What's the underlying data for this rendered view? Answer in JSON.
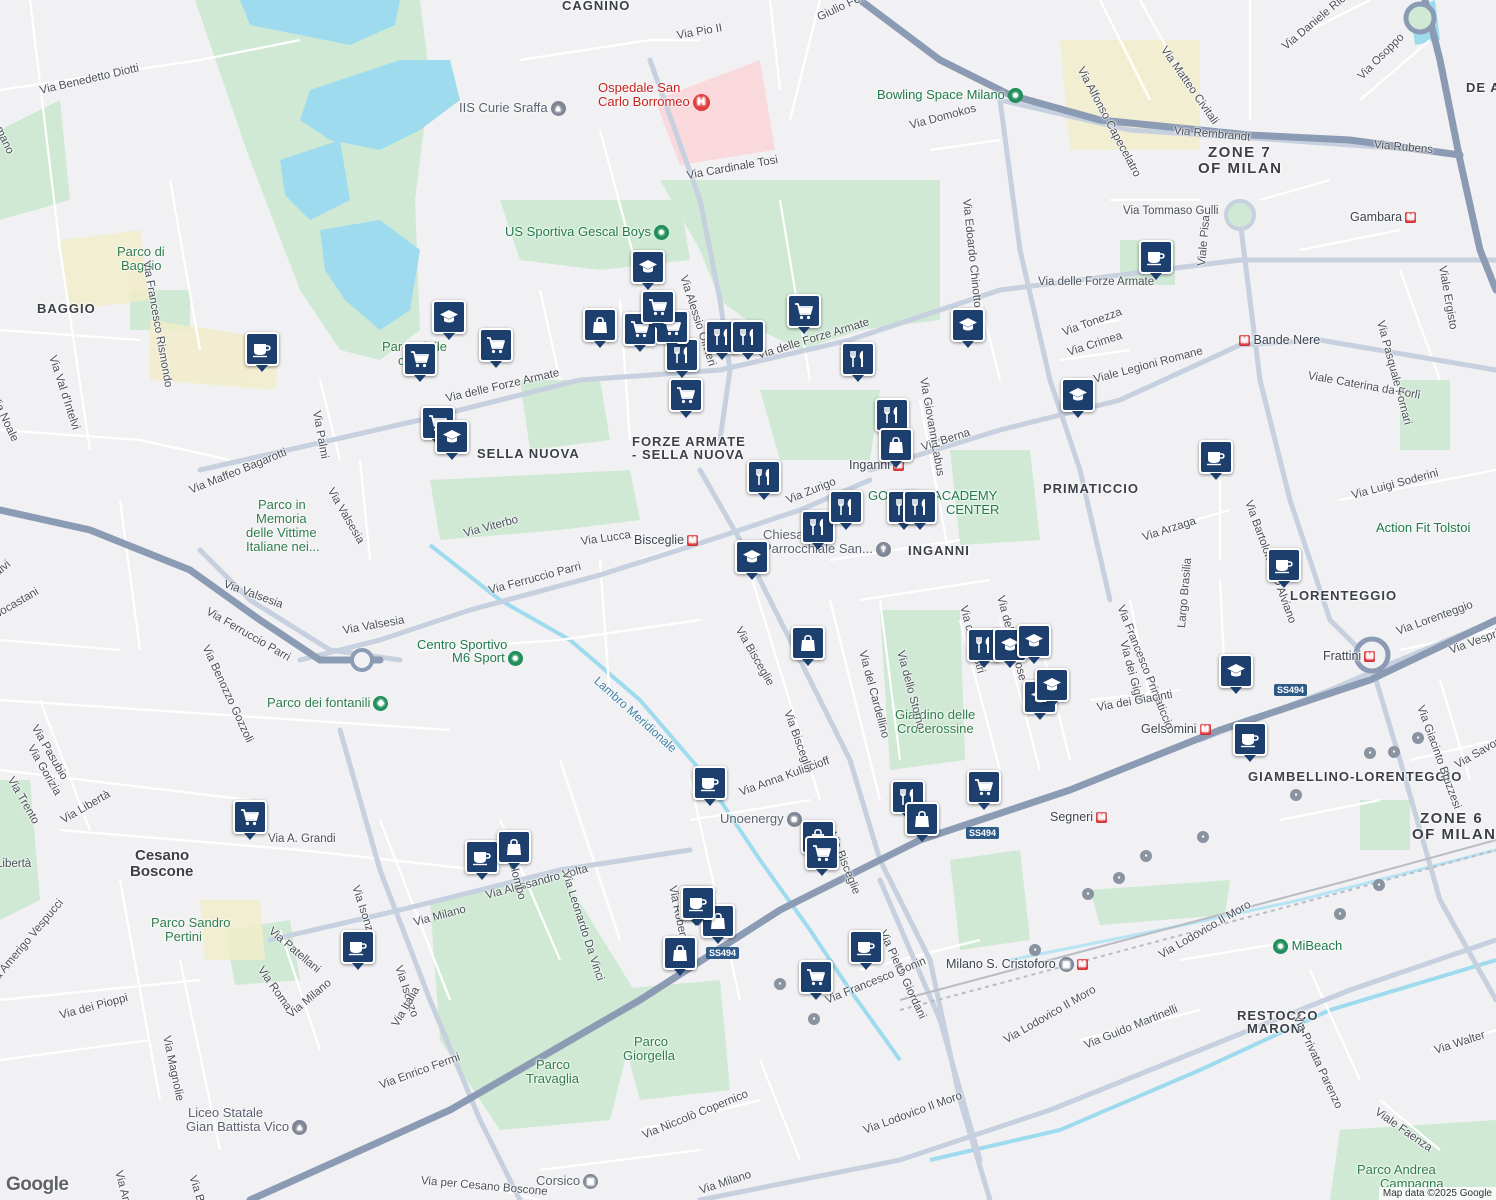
{
  "map": {
    "attribution": "Map data ©2025 Google",
    "logo": "Google",
    "colors": {
      "background": "#f1f1f3",
      "park": "#cfe9d4",
      "water": "#9fdbef",
      "major_road": "#8c9bb4",
      "marker": "#1d3f6e"
    }
  },
  "labels": {
    "areas": {
      "cagnino": "CAGNINO",
      "baggio": "BAGGIO",
      "sella_nuova": "SELLA NUOVA",
      "forze_armate_1": "FORZE ARMATE",
      "forze_armate_2": "- SELLA NUOVA",
      "primaticcio": "PRIMATICCIO",
      "inganni": "INGANNI",
      "lorenteggio": "LORENTEGGIO",
      "giambellino": "GIAMBELLINO-LORENTEGGIO",
      "restocco_1": "RESTOCCO",
      "restocco_2": "MARONI",
      "de_a": "DE A",
      "cesano_1": "Cesano",
      "cesano_2": "Boscone"
    },
    "zones": {
      "zone7_1": "ZONE 7",
      "zone7_2": "OF MILAN",
      "zone6_1": "ZONE 6",
      "zone6_2": "OF MILAN"
    },
    "parks": {
      "baggio_1": "Parco di",
      "baggio_2": "Baggio",
      "cave_1": "Parco delle",
      "cave_2": "cave",
      "memoria_1": "Parco in",
      "memoria_2": "Memoria",
      "memoria_3": "delle Vittime",
      "memoria_4": "Italiane nei...",
      "fontanili": "Parco dei fontanili",
      "crocerossine_1": "Giardino delle",
      "crocerossine_2": "Crocerossine",
      "pertini_1": "Parco Sandro",
      "pertini_2": "Pertini",
      "giorgella_1": "Parco",
      "giorgella_2": "Giorgella",
      "travaglia_1": "Parco",
      "travaglia_2": "Travaglia",
      "campagna_1": "Parco Andrea",
      "campagna_2": "Campagna"
    },
    "pois": {
      "ospedale_1": "Ospedale San",
      "ospedale_2": "Carlo Borromeo",
      "curie": "IIS Curie Sraffa",
      "gescal": "US Sportiva Gescal Boys",
      "bowling": "Bowling Space Milano",
      "golarsa_1": "GOLARSA ACADEMY",
      "golarsa_2": "CENTER",
      "chiesa_1": "Chiesa",
      "chiesa_2": "Parrocchiale San...",
      "centro_1": "Centro Sportivo",
      "centro_2": "M6 Sport",
      "action": "Action Fit Tolstoi",
      "unoenergy": "Unoenergy",
      "mibeach": "MiBeach",
      "liceo_1": "Liceo Statale",
      "liceo_2": "Gian Battista Vico",
      "corsico": "Corsico"
    },
    "metro": {
      "gambara": "Gambara",
      "bande_nere": "Bande Nere",
      "inganni": "Inganni",
      "bisceglie": "Bisceglie",
      "frattini": "Frattini",
      "gelsomini": "Gelsomini",
      "segneri": "Segneri",
      "cristoforo": "Milano S. Cristoforo"
    },
    "water": {
      "lambro": "Lambro Meridionale"
    },
    "shields": {
      "ss494": "SS494"
    },
    "streets": {
      "pio": "Via Pio II",
      "ferreri": "Giulio Ferreri",
      "cardinale": "Via Cardinale Tosi",
      "olivieri": "Via Alessio Olivieri",
      "forze1": "Via delle Forze Armate",
      "forze2": "Via delle Forze Armate",
      "forze3": "Via delle Forze Armate",
      "diotti": "Via Benedetto Diotti",
      "rismondo": "Via Francesco Rismondo",
      "romano": "Romano",
      "val": "Via Val d'Intelvi",
      "noale": "Via Noale",
      "palmi": "Via Palmi",
      "bagarotti": "Via Maffeo Bagarotti",
      "valsesia1": "Via Valsesia",
      "valsesia2": "Via Valsesia",
      "valsesia3": "Via Valsesia",
      "viterbo": "Via Viterbo",
      "lucca": "Via Lucca",
      "parri1": "Via Ferruccio Parri",
      "parri2": "Via Ferruccio Parri",
      "gozzoli": "Via Benozzo Gozzoli",
      "zurigo": "Via Zurigo",
      "berna": "Via Berna",
      "legioni": "Viale Legioni Romane",
      "domokos": "Via Domokos",
      "chinotto": "Via Edoardo Chinotto",
      "capecelatro": "Via Alfonso Capecelatro",
      "civitali": "Via Matteo Civitali",
      "ricciarelli": "Via Daniele Ricciarelli",
      "osoppo": "Via Osoppo",
      "rembrandt": "Via Rembrandt",
      "rubens": "Via Rubens",
      "gulli": "Via Tommaso Gulli",
      "tonezza": "Via Tonezza",
      "crimea": "Via Crimea",
      "labus": "Via Giovanni Labus",
      "pisa": "Viale Pisa",
      "fornari": "Via Pasquale Fornari",
      "caterina": "Viale Caterina da Forlì",
      "ergisto": "Viale Ergisto",
      "soderini": "Via Luigi Soderini",
      "arzaga": "Via Arzaga",
      "dalviano": "Via Bartolomeo D'Alviano",
      "brasilia": "Largo Brasilia",
      "gigli": "Via dei Gigli",
      "primaticcio": "Via Francesco Primaticcio",
      "mimose": "Via delle Mimose",
      "astri": "Via degli Astri",
      "storno": "Via dello Storno",
      "cardellino": "Via del Cardellino",
      "bisceglie1": "Via Bisceglie",
      "bisceglie2": "Via Bisceglie",
      "bisceglie3": "Via Bisceglie",
      "giacinti": "Via dei Giacinti",
      "lorenteggio": "Via Lorenteggio",
      "vespri": "Via Vespri",
      "bruzzesi": "Via Giacinto Bruzzesi",
      "savona": "Via Savona",
      "kuliscioff": "Via Anna Kuliscioff",
      "koch": "Via Robert Koch",
      "giordani": "Via Pietro Giordani",
      "gonin": "Via Francesco Gonin",
      "lodovico1": "Via Lodovico Il Moro",
      "lodovico2": "Via Lodovico Il Moro",
      "lodovico3": "Via Lodovico Il Moro",
      "martinelli": "Via Guido Martinelli",
      "parenzo": "Via Privata Parenzo",
      "faenza": "Viale Faenza",
      "walter": "Via Walter",
      "copernico": "Via Niccolò Copernico",
      "vmilano1": "Via Milano",
      "vmilano2": "Via Milano",
      "vmilano3": "Via Milano",
      "cesano": "Via per Cesano Boscone",
      "volta": "Via Alessandro Volta",
      "davinci": "Via Leonardo Da Vinci",
      "colombo": "Via Colombo",
      "isonzo1": "Via Isonzo",
      "isonzo2": "Via Isonzo",
      "fermi": "Via Enrico Fermi",
      "italia": "Via Italia",
      "grandi": "Via A. Grandi",
      "liberta1": "Via Libertà",
      "liberta2": "Libertà",
      "trento": "Via Trento",
      "gorizia": "Via Gorizia",
      "pasubio": "Via Pasubio",
      "cappocastani": "Via Cappocastani",
      "patellani": "Via Patellani",
      "roma": "Via Roma",
      "vespucci": "Via Amerigo Vespucci",
      "pioppi": "Via dei Pioppi",
      "magnolie": "Via Magnolie",
      "antonio": "Via Antonio",
      "cellini": "Via B. Cellini",
      "alvi": "alvi"
    }
  },
  "markers": [
    {
      "name": "school-marker",
      "icon": "school"
    },
    {
      "name": "school-marker",
      "icon": "school"
    },
    {
      "name": "shopping-bag-marker",
      "icon": "bag"
    },
    {
      "name": "grocery-cart-marker",
      "icon": "cart"
    },
    {
      "name": "grocery-cart-marker",
      "icon": "cart"
    },
    {
      "name": "grocery-cart-marker",
      "icon": "cart"
    },
    {
      "name": "restaurant-marker",
      "icon": "restaurant"
    },
    {
      "name": "restaurant-marker",
      "icon": "restaurant"
    },
    {
      "name": "restaurant-marker",
      "icon": "restaurant"
    },
    {
      "name": "grocery-cart-marker",
      "icon": "cart"
    },
    {
      "name": "grocery-cart-marker",
      "icon": "cart"
    },
    {
      "name": "school-marker",
      "icon": "school"
    },
    {
      "name": "grocery-cart-marker",
      "icon": "cart"
    },
    {
      "name": "grocery-cart-marker",
      "icon": "cart"
    },
    {
      "name": "cafe-marker",
      "icon": "cafe"
    },
    {
      "name": "grocery-cart-marker",
      "icon": "cart"
    },
    {
      "name": "school-marker",
      "icon": "school"
    },
    {
      "name": "restaurant-marker",
      "icon": "restaurant"
    },
    {
      "name": "restaurant-marker",
      "icon": "restaurant"
    },
    {
      "name": "shopping-bag-marker",
      "icon": "bag"
    },
    {
      "name": "school-marker",
      "icon": "school"
    },
    {
      "name": "cafe-marker",
      "icon": "cafe"
    },
    {
      "name": "school-marker",
      "icon": "school"
    },
    {
      "name": "restaurant-marker",
      "icon": "restaurant"
    },
    {
      "name": "restaurant-marker",
      "icon": "restaurant"
    },
    {
      "name": "restaurant-marker",
      "icon": "restaurant"
    },
    {
      "name": "restaurant-marker",
      "icon": "restaurant"
    },
    {
      "name": "restaurant-marker",
      "icon": "restaurant"
    },
    {
      "name": "cafe-marker",
      "icon": "cafe"
    },
    {
      "name": "school-marker",
      "icon": "school"
    },
    {
      "name": "cafe-marker",
      "icon": "cafe"
    },
    {
      "name": "shopping-bag-marker",
      "icon": "bag"
    },
    {
      "name": "restaurant-marker",
      "icon": "restaurant"
    },
    {
      "name": "school-marker",
      "icon": "school"
    },
    {
      "name": "school-marker",
      "icon": "school"
    },
    {
      "name": "school-marker",
      "icon": "school"
    },
    {
      "name": "school-marker",
      "icon": "school"
    },
    {
      "name": "cafe-marker",
      "icon": "cafe"
    },
    {
      "name": "cafe-marker",
      "icon": "cafe"
    },
    {
      "name": "restaurant-marker",
      "icon": "restaurant"
    },
    {
      "name": "shopping-bag-marker",
      "icon": "bag"
    },
    {
      "name": "grocery-cart-marker",
      "icon": "cart"
    },
    {
      "name": "shopping-bag-marker",
      "icon": "bag"
    },
    {
      "name": "grocery-cart-marker",
      "icon": "cart"
    },
    {
      "name": "grocery-cart-marker",
      "icon": "cart"
    },
    {
      "name": "cafe-marker",
      "icon": "cafe"
    },
    {
      "name": "shopping-bag-marker",
      "icon": "bag"
    },
    {
      "name": "cafe-marker",
      "icon": "cafe"
    },
    {
      "name": "grocery-cart-marker",
      "icon": "cart"
    },
    {
      "name": "shopping-bag-marker",
      "icon": "bag"
    },
    {
      "name": "shopping-bag-marker",
      "icon": "bag"
    },
    {
      "name": "cafe-marker",
      "icon": "cafe"
    },
    {
      "name": "grocery-cart-marker",
      "icon": "cart"
    },
    {
      "name": "cafe-marker",
      "icon": "cafe"
    }
  ]
}
